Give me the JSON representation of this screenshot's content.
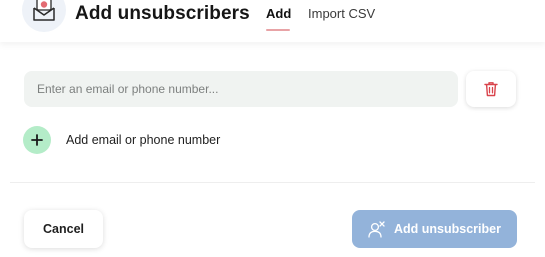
{
  "header": {
    "title": "Add unsubscribers",
    "icon": "envelope-icon",
    "tabs": [
      {
        "label": "Add",
        "active": true
      },
      {
        "label": "Import CSV",
        "active": false
      }
    ]
  },
  "form": {
    "email_input": {
      "placeholder": "Enter an email or phone number...",
      "value": ""
    },
    "delete_icon": "trash-icon",
    "add_row_label": "Add email or phone number",
    "add_row_icon": "plus-icon"
  },
  "footer": {
    "cancel_label": "Cancel",
    "submit_label": "Add unsubscriber",
    "submit_icon": "user-remove-icon"
  },
  "colors": {
    "accent_tab": "#e8a3a6",
    "add_circle": "#b4ecc8",
    "submit_bg": "#93b3da",
    "trash": "#d9434b"
  }
}
